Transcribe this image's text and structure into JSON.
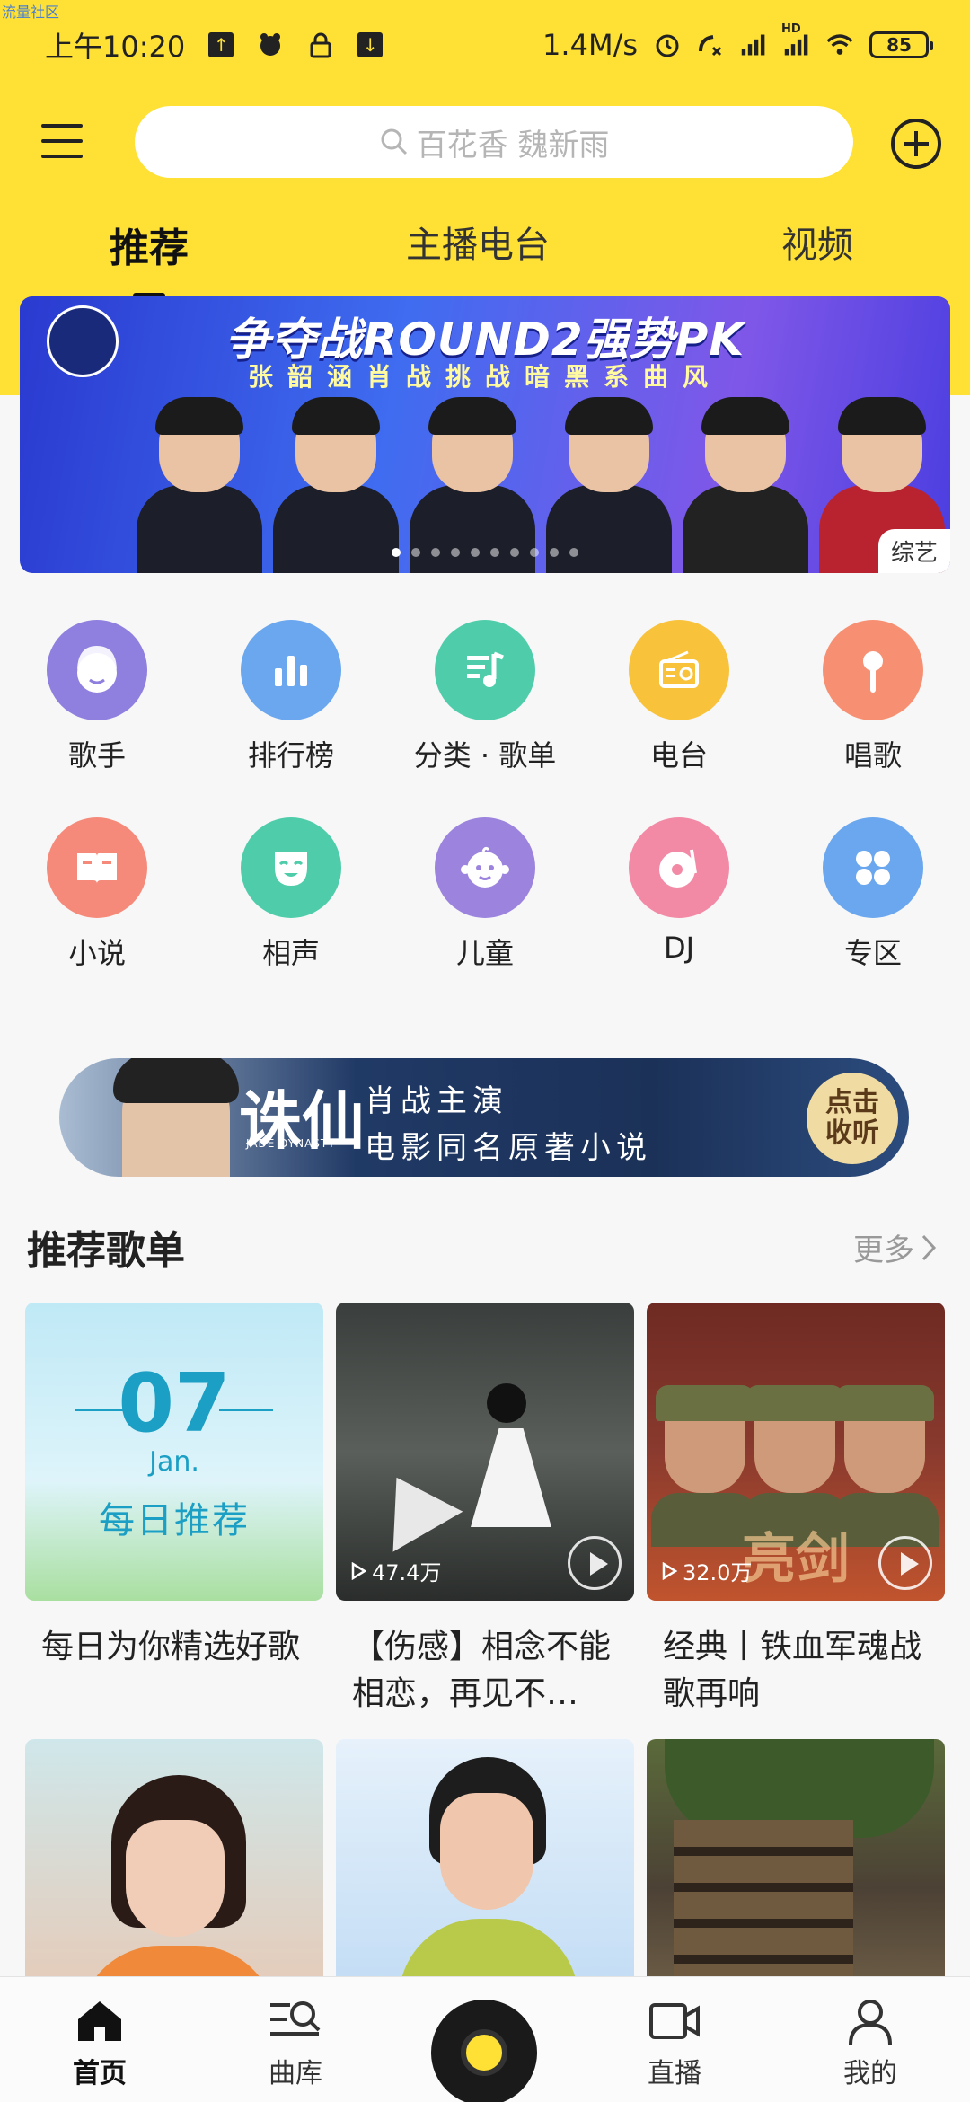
{
  "watermark": "流量社区",
  "status_bar": {
    "time": "上午10:20",
    "net_speed": "1.4M/s",
    "battery": "85",
    "hd": "HD"
  },
  "search": {
    "placeholder": "百花香  魏新雨"
  },
  "tabs": [
    {
      "label": "推荐",
      "active": true
    },
    {
      "label": "主播电台",
      "active": false
    },
    {
      "label": "视频",
      "active": false
    }
  ],
  "banner": {
    "title": "争夺战ROUND2强势PK",
    "subtitle": "张韶涵肖战挑战暗黑系曲风",
    "tag": "综艺",
    "dot_count": 10,
    "active_dot": 0
  },
  "categories": [
    {
      "label": "歌手",
      "icon": "singer-icon",
      "color": "#8f7fde"
    },
    {
      "label": "排行榜",
      "icon": "chart-icon",
      "color": "#6aa7ee"
    },
    {
      "label": "分类 · 歌单",
      "icon": "playlist-icon",
      "color": "#4fcdaa"
    },
    {
      "label": "电台",
      "icon": "radio-icon",
      "color": "#f8c23b"
    },
    {
      "label": "唱歌",
      "icon": "microphone-icon",
      "color": "#f79072"
    },
    {
      "label": "小说",
      "icon": "book-icon",
      "color": "#f58a7a"
    },
    {
      "label": "相声",
      "icon": "mask-icon",
      "color": "#4fcdaa"
    },
    {
      "label": "儿童",
      "icon": "child-icon",
      "color": "#9b83de"
    },
    {
      "label": "DJ",
      "icon": "dj-icon",
      "color": "#f28aa6"
    },
    {
      "label": "专区",
      "icon": "grid-icon",
      "color": "#6aa7ee"
    }
  ],
  "promo": {
    "title": "诛仙",
    "title_en": "JADE DYNASTY",
    "line1": "肖战主演",
    "line2": "电影同名原著小说",
    "button": "点击收听"
  },
  "section": {
    "title": "推荐歌单",
    "more": "更多"
  },
  "playlists": [
    {
      "desc": "每日为你精选好歌",
      "day": "07",
      "month": "Jan.",
      "cover_title": "每日推荐",
      "play_count": ""
    },
    {
      "desc": "【伤感】相念不能相恋，再见不…",
      "play_count": "47.4万"
    },
    {
      "desc": "经典丨铁血军魂战歌再响",
      "play_count": "32.0万",
      "cover_text": "亮剑"
    },
    {
      "desc": "",
      "play_count": ""
    },
    {
      "desc": "",
      "play_count": ""
    },
    {
      "desc": "",
      "play_count": ""
    }
  ],
  "bottom_nav": [
    {
      "label": "首页",
      "icon": "home-icon",
      "active": true
    },
    {
      "label": "曲库",
      "icon": "library-icon",
      "active": false
    },
    {
      "label": "",
      "icon": "player-icon",
      "active": false
    },
    {
      "label": "直播",
      "icon": "live-video-icon",
      "active": false
    },
    {
      "label": "我的",
      "icon": "profile-icon",
      "active": false
    }
  ],
  "colors": {
    "brand_yellow": "#fee134",
    "daily_blue": "#1b9fc4"
  }
}
